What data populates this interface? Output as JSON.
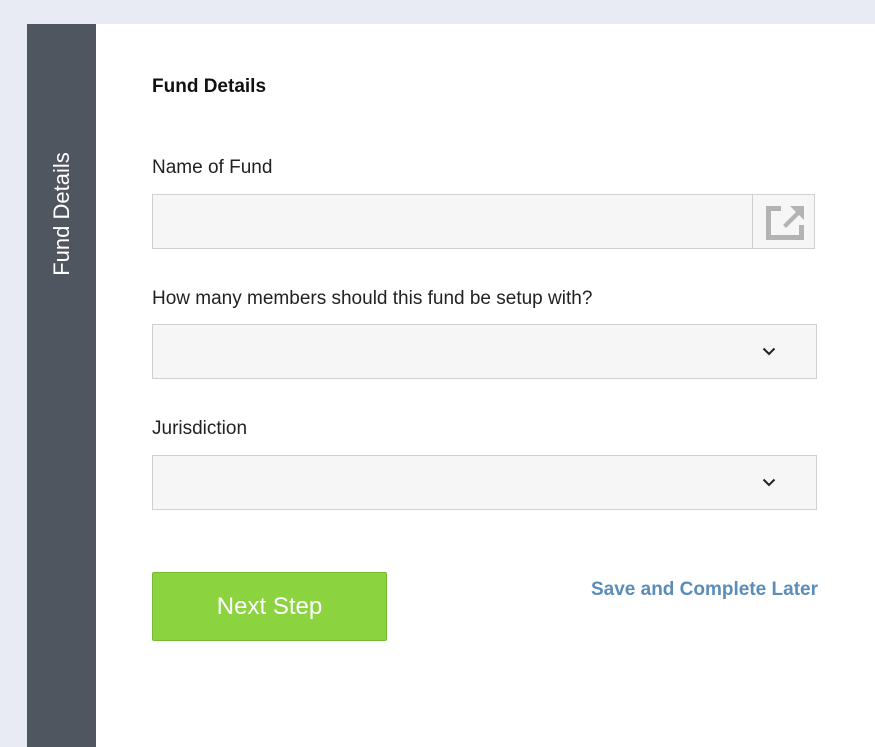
{
  "sidebar": {
    "label": "Fund Details"
  },
  "form": {
    "section_title": "Fund Details",
    "name_of_fund": {
      "label": "Name of Fund",
      "value": "",
      "placeholder": ""
    },
    "open_icon": "open-external-icon",
    "members": {
      "label": "How many members should this fund be setup with?",
      "selected": ""
    },
    "jurisdiction": {
      "label": "Jurisdiction",
      "selected": ""
    },
    "next_step_label": "Next Step",
    "save_later_label": "Save and Complete Later"
  },
  "colors": {
    "background": "#e8ebf3",
    "sidebar": "#4f5660",
    "primary_button": "#8bd33f",
    "link": "#5b8db8"
  }
}
